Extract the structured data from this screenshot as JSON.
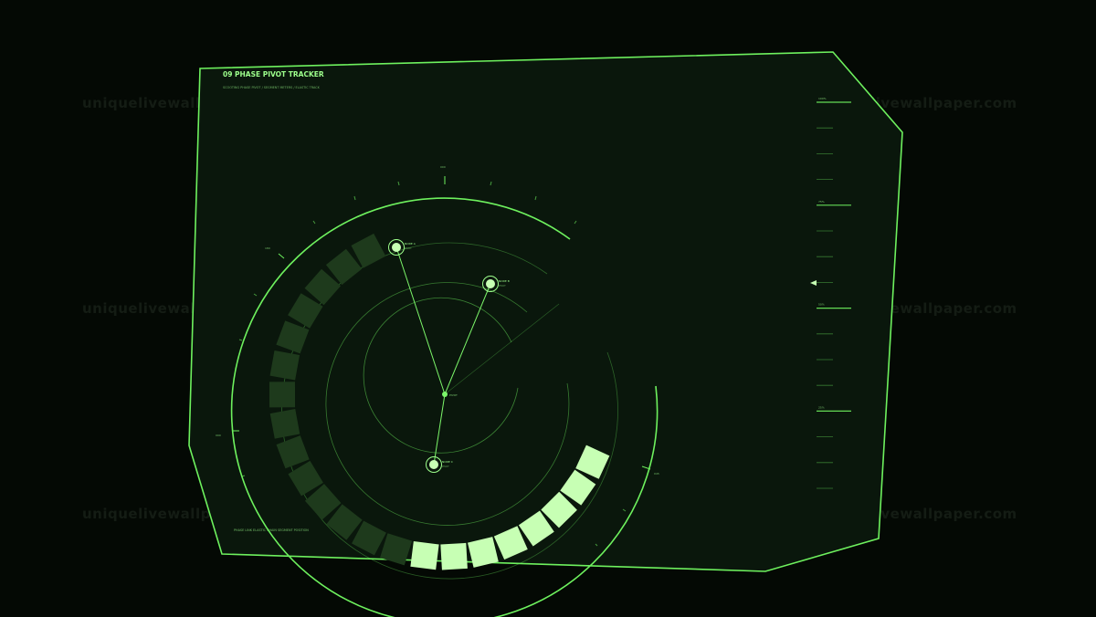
{
  "panel": {
    "index": "09",
    "title": "PHASE PIVOT TRACKER",
    "subtitle": "SCOOTING PHASE PIVOT / SEGMENT METERS / ELASTIC TRACK",
    "footer": "PHASE LINK  ELASTIC CHAIN  SEGMENT POSITION",
    "ring_top_label": "000",
    "ring_left_label": "180",
    "ring_left_low_label": "090",
    "ring_right_label": "045"
  },
  "nodes": [
    {
      "name": "node-a",
      "label": "NODE A",
      "sub": "PIVOT"
    },
    {
      "name": "node-b",
      "label": "NODE B",
      "sub": "PIVOT"
    },
    {
      "name": "node-c",
      "label": "NODE C",
      "sub": "PIVOT"
    }
  ],
  "center_label": "PIVOT",
  "segment_meter": {
    "total": 22,
    "active": 8
  },
  "scale": {
    "labels": [
      "100%",
      "75%",
      "50%",
      "25%"
    ]
  },
  "watermark": "uniquelivewallpaper.com",
  "colors": {
    "accent": "#7cf66a",
    "segment_active": "#c7ffb4",
    "segment_inactive": "#1e3a1c",
    "panel_fill": "#0a170c"
  }
}
